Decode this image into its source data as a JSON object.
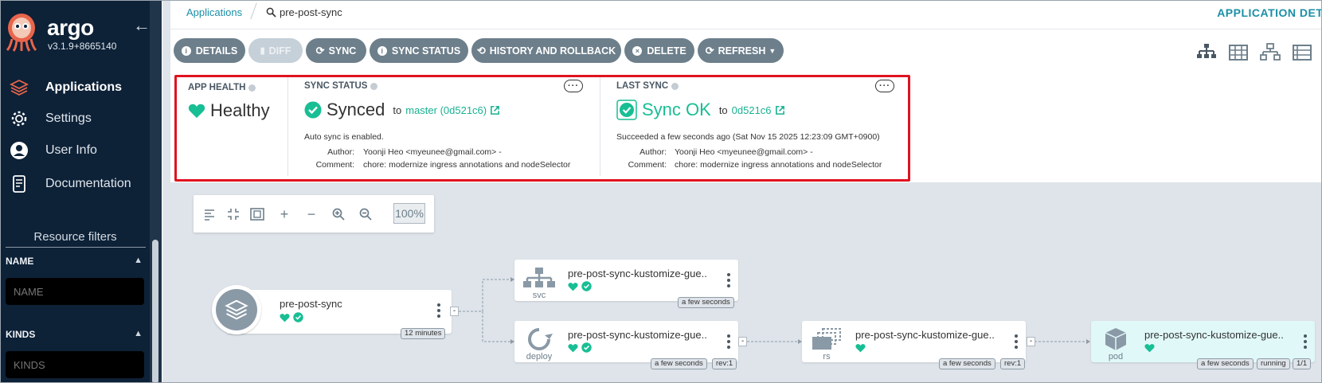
{
  "sidebar": {
    "brand": "argo",
    "version": "v3.1.9+8665140",
    "nav": [
      {
        "label": "Applications",
        "icon": "layers-icon"
      },
      {
        "label": "Settings",
        "icon": "gear-icon"
      },
      {
        "label": "User Info",
        "icon": "user-icon"
      },
      {
        "label": "Documentation",
        "icon": "book-icon"
      }
    ],
    "resource_filters": {
      "title": "Resource filters",
      "name_label": "NAME",
      "name_placeholder": "NAME",
      "kinds_label": "KINDS",
      "kinds_placeholder": "KINDS"
    }
  },
  "breadcrumb": {
    "parent": "Applications",
    "current": "pre-post-sync"
  },
  "page_title": "APPLICATION DETA",
  "toolbar": {
    "details": "DETAILS",
    "diff": "DIFF",
    "sync": "SYNC",
    "sync_status": "SYNC STATUS",
    "history": "HISTORY AND ROLLBACK",
    "delete": "DELETE",
    "refresh": "REFRESH"
  },
  "app_health": {
    "title": "APP HEALTH",
    "status": "Healthy"
  },
  "sync_status": {
    "title": "SYNC STATUS",
    "status": "Synced",
    "to": "to",
    "revision": "master (0d521c6)",
    "auto_sync": "Auto sync is enabled.",
    "author_label": "Author:",
    "author": "Yoonji Heo <myeunee@gmail.com> -",
    "comment_label": "Comment:",
    "comment": "chore: modernize ingress annotations and nodeSelector"
  },
  "last_sync": {
    "title": "LAST SYNC",
    "status": "Sync OK",
    "to": "to",
    "revision": "0d521c6",
    "succeeded": "Succeeded a few seconds ago (Sat Nov 15 2025 12:23:09 GMT+0900)",
    "author_label": "Author:",
    "author": "Yoonji Heo <myeunee@gmail.com> -",
    "comment_label": "Comment:",
    "comment": "chore: modernize ingress annotations and nodeSelector"
  },
  "zoom": "100%",
  "nodes": {
    "app": {
      "name": "pre-post-sync",
      "age": "12 minutes"
    },
    "svc": {
      "name": "pre-post-sync-kustomize-gue...",
      "kind": "svc",
      "age": "a few seconds"
    },
    "deploy": {
      "name": "pre-post-sync-kustomize-gue...",
      "kind": "deploy",
      "age": "a few seconds",
      "rev": "rev:1"
    },
    "rs": {
      "name": "pre-post-sync-kustomize-gue...",
      "kind": "rs",
      "age": "a few seconds",
      "rev": "rev:1"
    },
    "pod": {
      "name": "pre-post-sync-kustomize-gue...",
      "kind": "pod",
      "age": "a few seconds",
      "state": "running",
      "ready": "1/1"
    }
  },
  "colors": {
    "sidebar_bg": "#0d2137",
    "accent": "#1a8fa6",
    "healthy": "#18be94",
    "highlight_border": "#e0121f"
  }
}
